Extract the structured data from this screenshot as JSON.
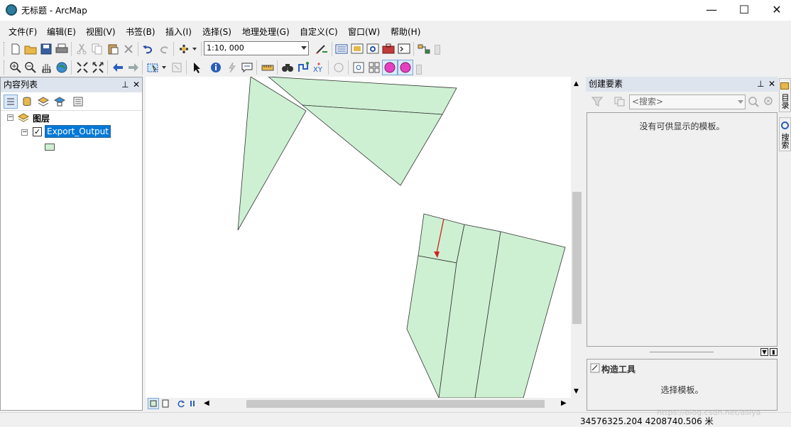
{
  "window": {
    "title": "无标题 - ArcMap",
    "minimize_icon": "—",
    "maximize_icon": "☐",
    "close_icon": "✕"
  },
  "menu": [
    "文件(F)",
    "编辑(E)",
    "视图(V)",
    "书签(B)",
    "插入(I)",
    "选择(S)",
    "地理处理(G)",
    "自定义(C)",
    "窗口(W)",
    "帮助(H)"
  ],
  "toolbar": {
    "scale": "1:10, 000"
  },
  "toc": {
    "title": "内容列表",
    "pin": "⊥",
    "close": "✕",
    "layers_root": "图层",
    "layer_name": "Export_Output",
    "layer_checked": true,
    "fill_color": "#cdf0d2"
  },
  "create_features": {
    "title": "创建要素",
    "search_placeholder": "<搜索>",
    "empty_message": "没有可供显示的模板。",
    "construction_title": "构造工具",
    "construction_message": "选择模板。"
  },
  "side_tabs": [
    "目录",
    "搜索"
  ],
  "status": {
    "coordinates": "34576325.204  4208740.506 米",
    "watermark": "https://blog.csdn.net/asiya"
  }
}
